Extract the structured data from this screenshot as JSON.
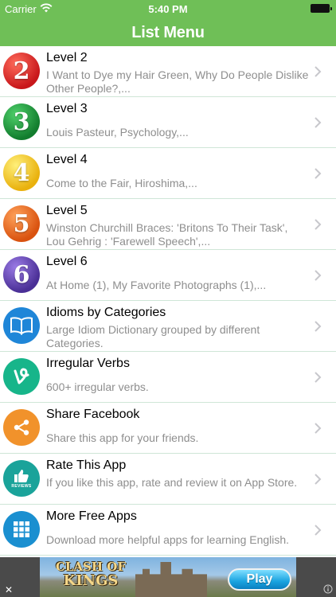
{
  "status_bar": {
    "carrier": "Carrier",
    "time": "5:40 PM"
  },
  "header": {
    "title": "List Menu",
    "bg_color": "#6fbf57"
  },
  "items": [
    {
      "icon": "level-2-icon",
      "badge": "2",
      "color": "#d9201f",
      "title": "Level 2",
      "subtitle": "I Want to Dye my Hair Green, Why Do People Dislike Other People?,..."
    },
    {
      "icon": "level-3-icon",
      "badge": "3",
      "color": "#1a9a3c",
      "title": "Level 3",
      "subtitle": "Louis Pasteur, Psychology,..."
    },
    {
      "icon": "level-4-icon",
      "badge": "4",
      "color": "#f0c419",
      "title": "Level 4",
      "subtitle": "Come to the Fair, Hiroshima,..."
    },
    {
      "icon": "level-5-icon",
      "badge": "5",
      "color": "#ea6a1f",
      "title": "Level 5",
      "subtitle": "Winston Churchill Braces: 'Britons To Their Task', Lou Gehrig : 'Farewell Speech',..."
    },
    {
      "icon": "level-6-icon",
      "badge": "6",
      "color": "#5a3ea8",
      "title": "Level 6",
      "subtitle": "At Home (1), My Favorite Photographs (1),..."
    },
    {
      "icon": "book-icon",
      "color": "#1f86d8",
      "title": "Idioms by Categories",
      "subtitle": "Large Idiom Dictionary grouped by different Categories."
    },
    {
      "icon": "vine-icon",
      "color": "#17b58a",
      "title": "Irregular Verbs",
      "subtitle": "600+ irregular verbs."
    },
    {
      "icon": "share-icon",
      "color": "#f1922b",
      "title": "Share Facebook",
      "subtitle": "Share this app for your friends."
    },
    {
      "icon": "thumbs-up-reviews-icon",
      "badge": "REVIEWS",
      "color": "#1aa39a",
      "title": "Rate This App",
      "subtitle": "If you like this app, rate and review it on App Store."
    },
    {
      "icon": "grid-icon",
      "color": "#1a8fd0",
      "title": "More Free Apps",
      "subtitle": "Download more helpful apps for learning English."
    }
  ],
  "banner": {
    "logo_line1": "CLASH OF",
    "logo_line2": "KINGS",
    "play_label": "Play",
    "close_symbol": "✕"
  }
}
